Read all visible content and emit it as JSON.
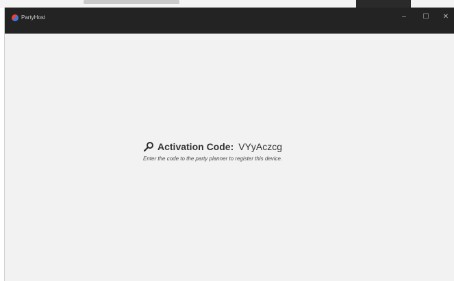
{
  "window": {
    "title": "PartyHost",
    "controls": {
      "minimize": "–",
      "maximize": "☐",
      "close": "✕"
    }
  },
  "activation": {
    "label": "Activation Code:",
    "code": "VYyAczcg",
    "hint": "Enter the code to the party planner to register this device.",
    "icon": "key-icon"
  },
  "colors": {
    "titlebar": "#232323",
    "content_bg": "#f2f2f2",
    "text": "#333333"
  }
}
